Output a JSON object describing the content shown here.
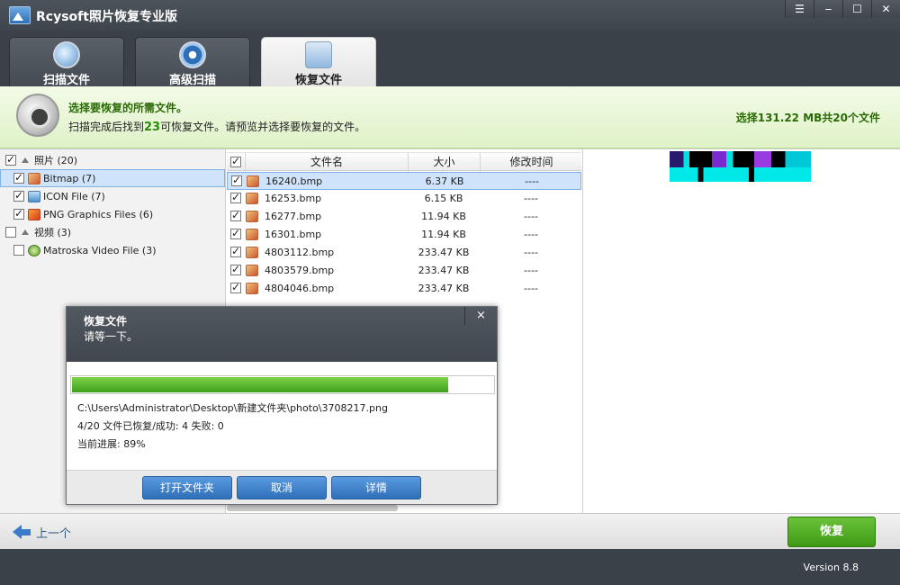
{
  "window": {
    "title": "Rcysoft照片恢复专业版",
    "buttons": [
      "menu",
      "minimize",
      "maximize",
      "close"
    ]
  },
  "tabs": [
    {
      "label": "扫描文件",
      "icon": "magnifier-icon",
      "active": false
    },
    {
      "label": "高级扫描",
      "icon": "gear-icon",
      "active": false
    },
    {
      "label": "恢复文件",
      "icon": "recover-icon",
      "active": true
    }
  ],
  "info": {
    "heading": "选择要恢复的所需文件。",
    "sub_prefix": "扫描完成后找到",
    "sub_count": "23",
    "sub_suffix": "可恢复文件。请预览并选择要恢复的文件。",
    "summary": "选择131.22 MB共20个文件"
  },
  "tree": [
    {
      "label": "照片 (20)",
      "level": 0,
      "checked": true,
      "expanded": true,
      "icon": null,
      "selected": false
    },
    {
      "label": "Bitmap (7)",
      "level": 1,
      "checked": true,
      "icon": "bmp-icon",
      "selected": true
    },
    {
      "label": "ICON File (7)",
      "level": 1,
      "checked": true,
      "icon": "ico-icon",
      "selected": false
    },
    {
      "label": "PNG Graphics Files (6)",
      "level": 1,
      "checked": true,
      "icon": "png-icon",
      "selected": false
    },
    {
      "label": "视频 (3)",
      "level": 0,
      "checked": false,
      "expanded": true,
      "icon": null,
      "selected": false
    },
    {
      "label": "Matroska Video File (3)",
      "level": 1,
      "checked": false,
      "icon": "mkv-icon",
      "selected": false
    }
  ],
  "file_list": {
    "columns": [
      "文件名",
      "大小",
      "修改时间"
    ],
    "rows": [
      {
        "name": "16240.bmp",
        "size": "6.37 KB",
        "modified": "----",
        "checked": true,
        "selected": true
      },
      {
        "name": "16253.bmp",
        "size": "6.15 KB",
        "modified": "----",
        "checked": true,
        "selected": false
      },
      {
        "name": "16277.bmp",
        "size": "11.94 KB",
        "modified": "----",
        "checked": true,
        "selected": false
      },
      {
        "name": "16301.bmp",
        "size": "11.94 KB",
        "modified": "----",
        "checked": true,
        "selected": false
      },
      {
        "name": "4803112.bmp",
        "size": "233.47 KB",
        "modified": "----",
        "checked": true,
        "selected": false
      },
      {
        "name": "4803579.bmp",
        "size": "233.47 KB",
        "modified": "----",
        "checked": true,
        "selected": false
      },
      {
        "name": "4804046.bmp",
        "size": "233.47 KB",
        "modified": "----",
        "checked": true,
        "selected": false
      }
    ]
  },
  "dialog": {
    "title": "恢复文件",
    "subtitle": "请等一下。",
    "close": "×",
    "progress_fraction": 0.89,
    "current_path": "C:\\Users\\Administrator\\Desktop\\新建文件夹\\photo\\3708217.png",
    "status_line": "4/20 文件已恢复/成功: 4 失败: 0",
    "progress_text": "当前进展:  89%",
    "buttons": {
      "open_folder": "打开文件夹",
      "cancel": "取消",
      "details": "详情"
    }
  },
  "bottom": {
    "back_label": "上一个",
    "recover_label": "恢复",
    "version": "Version 8.8"
  }
}
